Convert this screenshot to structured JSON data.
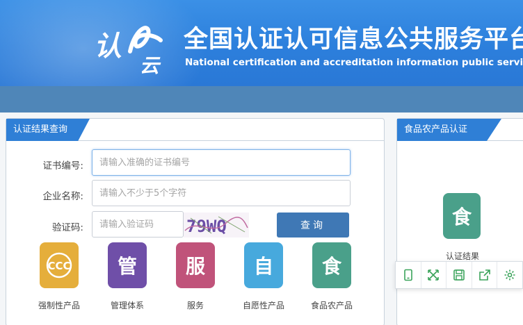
{
  "header": {
    "title": "全国认证认可信息公共服务平台",
    "subtitle": "National certification and accreditation information public service platform",
    "logo_text_1": "认",
    "logo_text_2": "云"
  },
  "left_panel": {
    "tab": "认证结果查询",
    "fields": {
      "cert_no": {
        "label": "证书编号:",
        "placeholder": "请输入准确的证书编号"
      },
      "company": {
        "label": "企业名称:",
        "placeholder": "请输入不少于5个字符"
      },
      "captcha": {
        "label": "验证码:",
        "placeholder": "请输入验证码",
        "image_text": "79WQ"
      }
    },
    "query_button": "查询",
    "categories": [
      {
        "glyph": "CCC",
        "label": "强制性产品",
        "color": "#e5ae3b"
      },
      {
        "glyph": "管",
        "label": "管理体系",
        "color": "#6f4fa8"
      },
      {
        "glyph": "服",
        "label": "服务",
        "color": "#c0537a"
      },
      {
        "glyph": "自",
        "label": "自愿性产品",
        "color": "#47a9dd"
      },
      {
        "glyph": "食",
        "label": "食品农产品",
        "color": "#4aa08a"
      }
    ]
  },
  "right_panel": {
    "tab": "食品农产品认证",
    "tile_glyph": "食",
    "tile_label": "认证结果"
  },
  "toolbar": [
    "mobile-icon",
    "fullscreen-icon",
    "save-icon",
    "share-icon",
    "settings-icon"
  ],
  "colors": {
    "brand_blue": "#2f7fd6",
    "nav": "#4f86b8",
    "button": "#3f78b5",
    "toolbar_icon": "#3aa35a"
  }
}
